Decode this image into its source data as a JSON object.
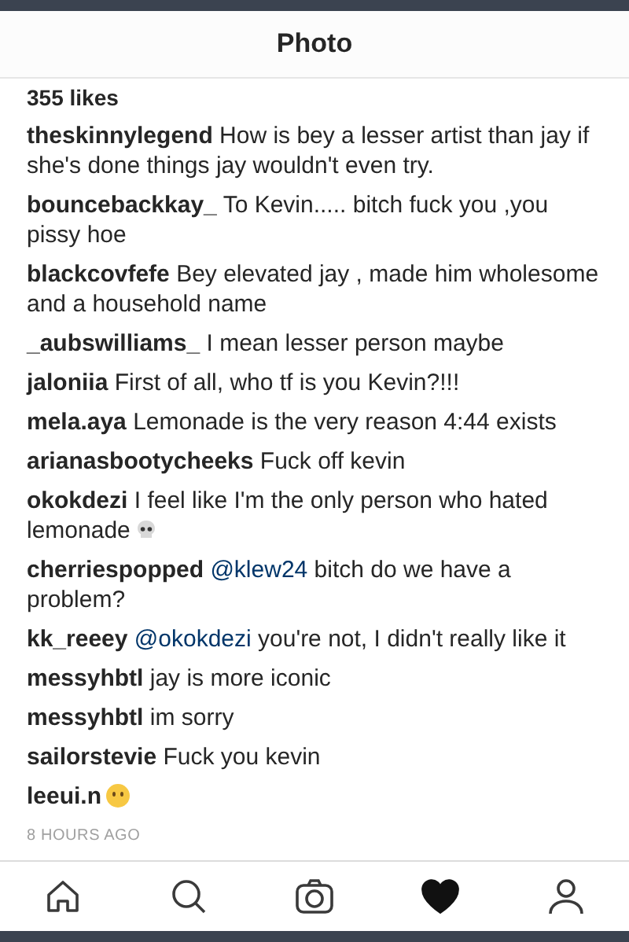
{
  "header": {
    "title": "Photo"
  },
  "likes": "355 likes",
  "comments": [
    {
      "user": "theskinnylegend",
      "text": "How is bey a lesser artist than jay if she's done things jay wouldn't even try."
    },
    {
      "user": "bouncebackkay_",
      "text": "To Kevin..... bitch fuck you ,you pissy hoe"
    },
    {
      "user": "blackcovfefe",
      "text": "Bey elevated jay , made him wholesome and a household name"
    },
    {
      "user": "_aubswilliams_",
      "text": "I mean lesser person maybe"
    },
    {
      "user": "jaloniia",
      "text": "First of all, who tf is you Kevin?!!!"
    },
    {
      "user": "mela.aya",
      "text": "Lemonade is the very reason 4:44 exists"
    },
    {
      "user": "arianasbootycheeks",
      "text": "Fuck off kevin"
    },
    {
      "user": "okokdezi",
      "text": "I feel like I'm the only person who hated lemonade",
      "kind": "skull"
    },
    {
      "user": "cherriespopped",
      "mention": "@klew24",
      "text": "bitch do we have a problem?"
    },
    {
      "user": "kk_reeey",
      "mention": "@okokdezi",
      "text": "you're not, I didn't really like it"
    },
    {
      "user": "messyhbtl",
      "text": "jay is more iconic"
    },
    {
      "user": "messyhbtl",
      "text": "im sorry"
    },
    {
      "user": "sailorstevie",
      "text": "Fuck you kevin"
    },
    {
      "user": "leeui.n",
      "kind": "face"
    }
  ],
  "time": "8 HOURS AGO",
  "nav": [
    {
      "kind": "home",
      "selected": false
    },
    {
      "kind": "search",
      "selected": false
    },
    {
      "kind": "camera",
      "selected": false
    },
    {
      "kind": "heart",
      "selected": true
    },
    {
      "kind": "profile",
      "selected": false
    }
  ]
}
